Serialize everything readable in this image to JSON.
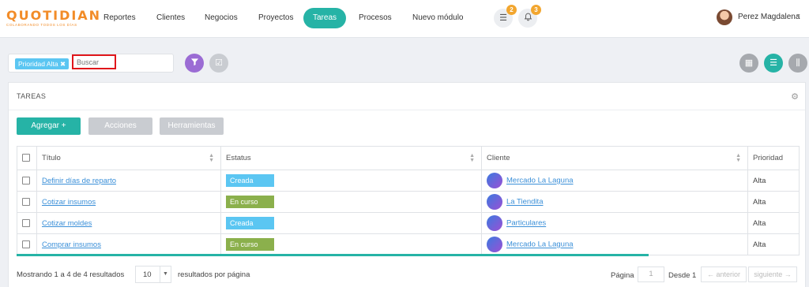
{
  "header": {
    "logo_word": "QUOTIDIAN",
    "logo_tagline": "COLABORANDO TODOS LOS DÍAS",
    "nav": [
      {
        "label": "Reportes",
        "active": false
      },
      {
        "label": "Clientes",
        "active": false
      },
      {
        "label": "Negocios",
        "active": false
      },
      {
        "label": "Proyectos",
        "active": false
      },
      {
        "label": "Tareas",
        "active": true
      },
      {
        "label": "Procesos",
        "active": false
      },
      {
        "label": "Nuevo módulo",
        "active": false
      }
    ],
    "messages_badge": "2",
    "notifications_badge": "3",
    "user_name": "Perez Magdalena"
  },
  "filters": {
    "chip_label": "Prioridad Alta",
    "search_placeholder": "Buscar"
  },
  "panel": {
    "title": "TAREAS",
    "add_button": "Agregar +",
    "actions_button": "Acciones",
    "tools_button": "Herramientas"
  },
  "table": {
    "columns": [
      "Título",
      "Estatus",
      "Cliente",
      "Prioridad"
    ],
    "rows": [
      {
        "title": "Definir días de reparto",
        "status": "Creada",
        "client": "Mercado La Laguna",
        "priority": "Alta"
      },
      {
        "title": "Cotizar insumos",
        "status": "En curso",
        "client": "La Tiendita",
        "priority": "Alta"
      },
      {
        "title": "Cotizar moldes",
        "status": "Creada",
        "client": "Particulares",
        "priority": "Alta"
      },
      {
        "title": "Comprar insumos",
        "status": "En curso",
        "client": "Mercado La Laguna",
        "priority": "Alta"
      }
    ]
  },
  "footer": {
    "results_text": "Mostrando 1 a 4 de 4 resultados",
    "per_page_value": "10",
    "per_page_label": "resultados por página",
    "page_label": "Página",
    "page_value": "1",
    "from_label": "Desde",
    "from_value": "1",
    "prev_label": "← anterior",
    "next_label": "siguiente →"
  },
  "colors": {
    "accent": "#26b3a6",
    "status_creada": "#5bc6f2",
    "status_en_curso": "#8bb04c",
    "logo": "#f28c28",
    "filter_button": "#9b6cd4",
    "badge": "#f2a62f"
  }
}
